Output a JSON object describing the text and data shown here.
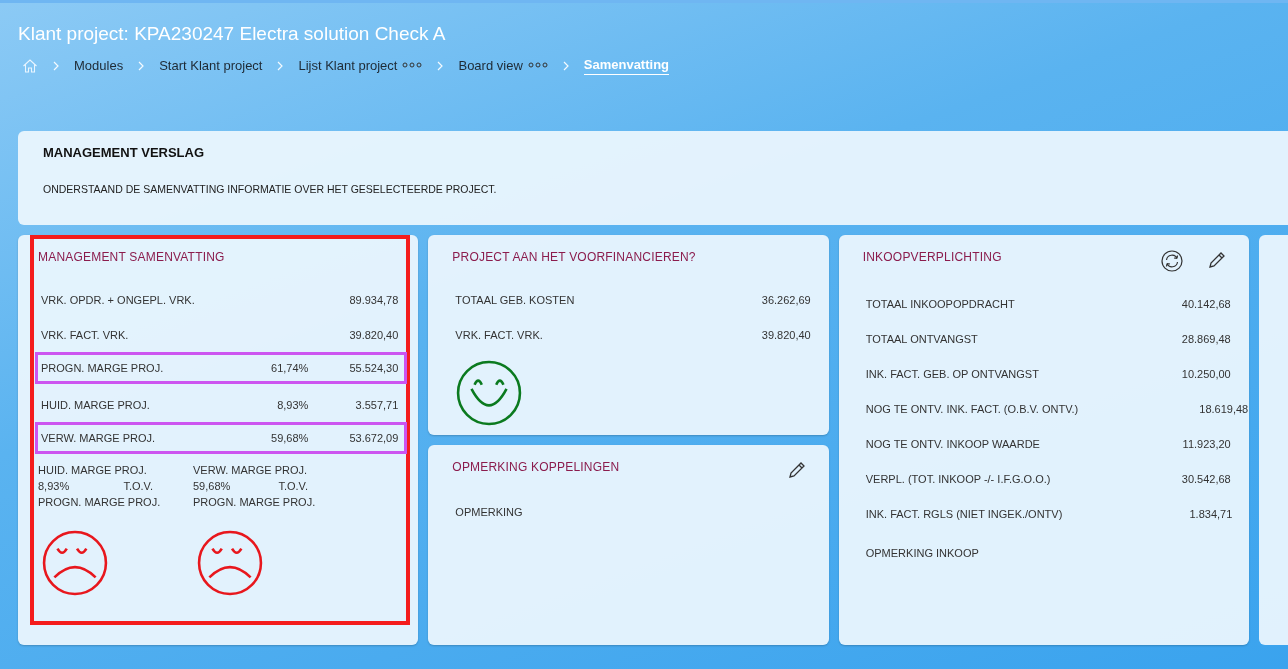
{
  "page": {
    "title": "Klant project: KPA230247 Electra solution Check A"
  },
  "breadcrumb": [
    {
      "label": "Modules",
      "has_menu": false,
      "selected": false
    },
    {
      "label": "Start Klant project",
      "has_menu": false,
      "selected": false
    },
    {
      "label": "Lijst Klant project",
      "has_menu": true,
      "selected": false
    },
    {
      "label": "Board view",
      "has_menu": true,
      "selected": false
    },
    {
      "label": "Samenvatting",
      "has_menu": false,
      "selected": true
    }
  ],
  "header": {
    "title": "MANAGEMENT VERSLAG",
    "description": "ONDERSTAAND DE SAMENVATTING INFORMATIE OVER HET GESELECTEERDE PROJECT."
  },
  "columns": [
    [
      {
        "title": "MANAGEMENT SAMENVATTING",
        "outlined": true,
        "refreshable": false,
        "editable": false,
        "rows": [
          {
            "label": "VRK. OPDR. + ONGEPL. VRK.",
            "value": "89.934,78",
            "highlighted": false
          },
          {
            "label": "VRK. FACT. VRK.",
            "value": "39.820,40",
            "highlighted": false
          },
          {
            "label": "PROGN. MARGE PROJ.",
            "percent": "61,74%",
            "value": "55.524,30",
            "highlighted": true
          },
          {
            "label": "HUID. MARGE PROJ.",
            "percent": "8,93%",
            "value": "3.557,71",
            "highlighted": false
          },
          {
            "label": "VERW. MARGE PROJ.",
            "percent": "59,68%",
            "value": "53.672,09",
            "highlighted": true
          }
        ],
        "comparisons": [
          {
            "metric": "HUID. MARGE PROJ.",
            "percent": "8,93%",
            "relation": "T.O.V.",
            "reference": "PROGN. MARGE PROJ.",
            "positive": false
          },
          {
            "metric": "VERW. MARGE PROJ.",
            "percent": "59,68%",
            "relation": "T.O.V.",
            "reference": "PROGN. MARGE PROJ.",
            "positive": false
          }
        ]
      }
    ],
    [
      {
        "title": "PROJECT AAN HET VOORFINANCIEREN?",
        "outlined": false,
        "refreshable": false,
        "editable": false,
        "rows": [
          {
            "label": "TOTAAL GEB. KOSTEN",
            "value": "36.262,69",
            "highlighted": false
          },
          {
            "label": "VRK. FACT. VRK.",
            "value": "39.820,40",
            "highlighted": false
          }
        ],
        "positive": true
      },
      {
        "title": "OPMERKING KOPPELINGEN",
        "outlined": false,
        "refreshable": false,
        "editable": true,
        "rows": [
          {
            "label": "OPMERKING",
            "highlighted": false
          }
        ]
      }
    ],
    [
      {
        "title": "INKOOPVERPLICHTING",
        "outlined": false,
        "refreshable": true,
        "editable": true,
        "rows": [
          {
            "label": "TOTAAL INKOOPOPDRACHT",
            "value": "40.142,68",
            "highlighted": false
          },
          {
            "label": "TOTAAL ONTVANGST",
            "value": "28.869,48",
            "highlighted": false
          },
          {
            "label": "INK. FACT. GEB. OP ONTVANGST",
            "value": "10.250,00",
            "highlighted": false
          },
          {
            "label": "NOG TE ONTV. INK. FACT. (O.B.V. ONTV.)",
            "value": "18.619,48",
            "highlighted": false
          },
          {
            "label": "NOG TE ONTV. INKOOP WAARDE",
            "value": "11.923,20",
            "highlighted": false
          },
          {
            "label": "VERPL. (TOT. INKOOP -/- I.F.G.O.O.)",
            "value": "30.542,68",
            "highlighted": false
          },
          {
            "label": "INK. FACT. RGLS (NIET INGEK./ONTV)",
            "value": "1.834,71",
            "highlighted": false
          },
          {
            "label": "OPMERKING INKOOP",
            "highlighted": false
          }
        ]
      }
    ]
  ]
}
